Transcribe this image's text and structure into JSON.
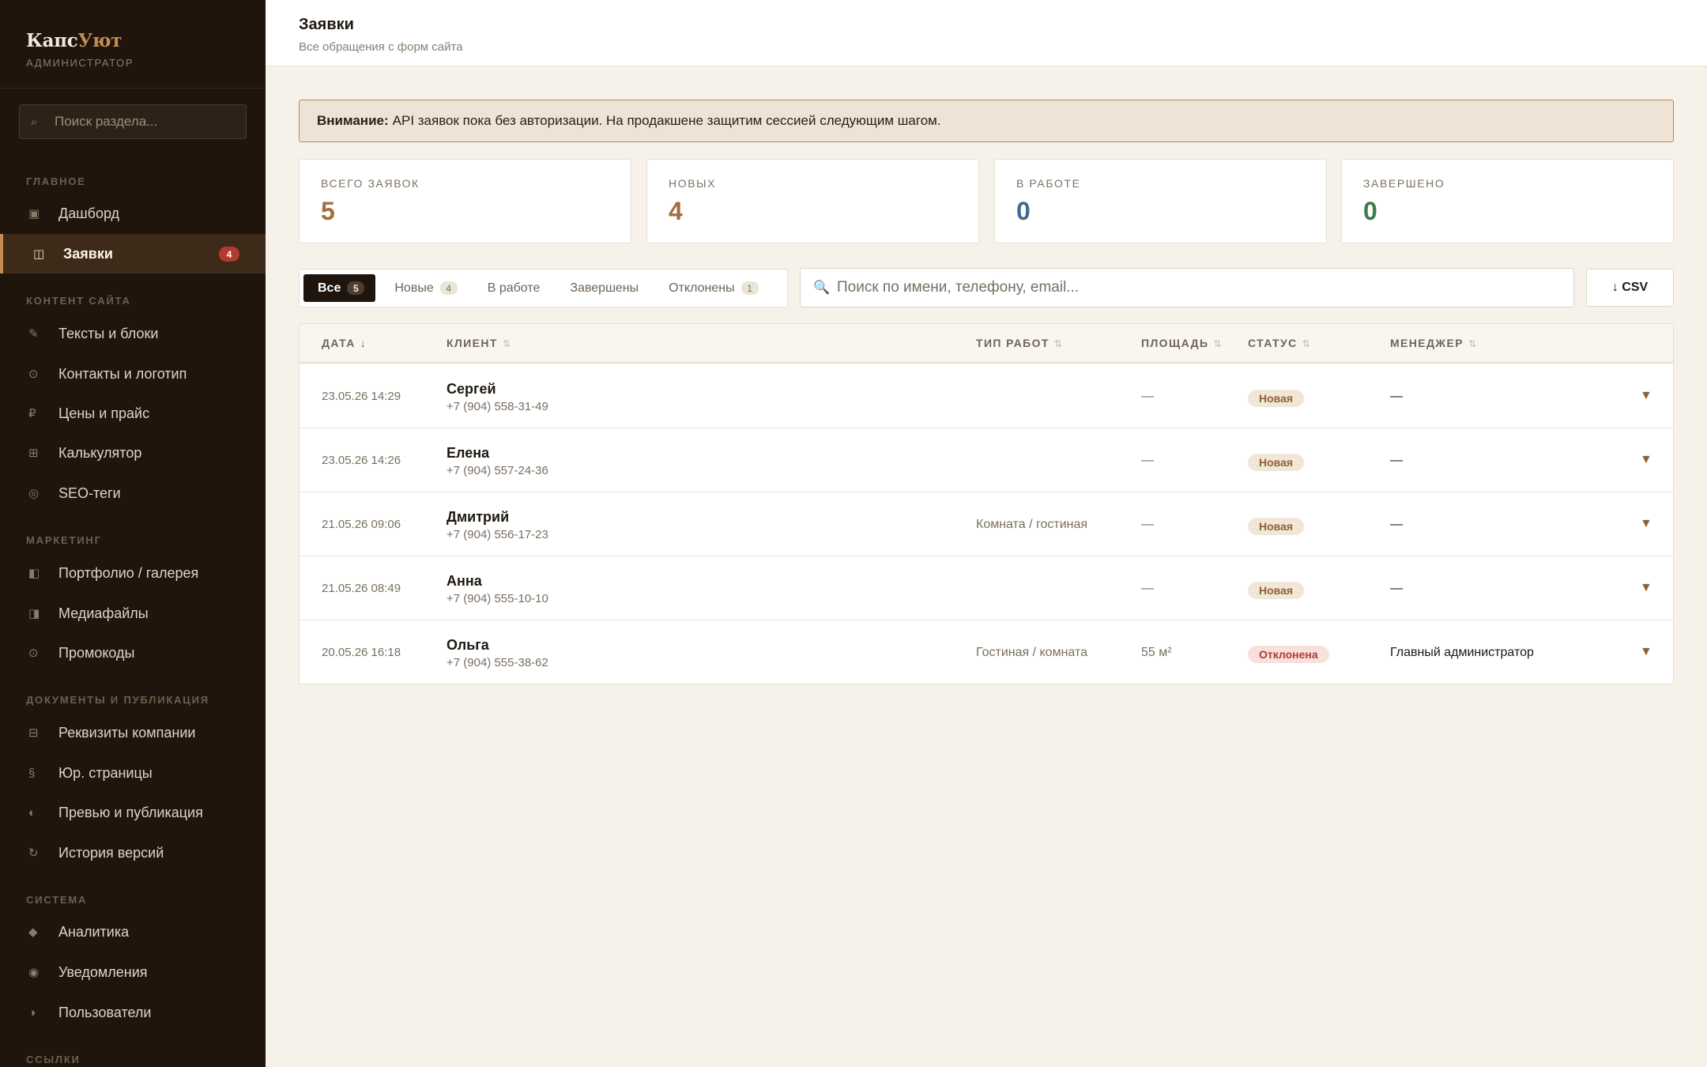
{
  "brand": {
    "part1": "Капс",
    "part2": "Уют",
    "role": "АДМИНИСТРАТОР"
  },
  "sidebar": {
    "search_placeholder": "Поиск раздела...",
    "sections": {
      "main": "ГЛАВНОЕ",
      "content": "КОНТЕНТ САЙТА",
      "marketing": "МАРКЕТИНГ",
      "docs": "ДОКУМЕНТЫ И ПУБЛИКАЦИЯ",
      "system": "СИСТЕМА",
      "links": "ССЫЛКИ"
    },
    "items": {
      "dashboard": "Дашборд",
      "requests": "Заявки",
      "requests_badge": "4",
      "texts": "Тексты и блоки",
      "contacts": "Контакты и логотип",
      "prices": "Цены и прайс",
      "calculator": "Калькулятор",
      "seo": "SEO-теги",
      "portfolio": "Портфолио / галерея",
      "media": "Медиафайлы",
      "promo": "Промокоды",
      "company": "Реквизиты компании",
      "legal": "Юр. страницы",
      "preview": "Превью и публикация",
      "history": "История версий",
      "analytics": "Аналитика",
      "notifications": "Уведомления",
      "users": "Пользователи"
    },
    "icons": {
      "dashboard": "▣",
      "requests": "◫",
      "texts": "✎",
      "contacts": "⊙",
      "prices": "₽",
      "calculator": "⊞",
      "seo": "◎",
      "portfolio": "◧",
      "media": "◨",
      "promo": "⊙",
      "company": "⊟",
      "legal": "§",
      "preview": "◐",
      "history": "↻",
      "analytics": "◆",
      "notifications": "◉",
      "users": "◑"
    }
  },
  "header": {
    "title": "Заявки",
    "subtitle": "Все обращения с форм сайта"
  },
  "alert": {
    "label": "Внимание:",
    "text": "API заявок пока без авторизации. На продакшене защитим сессией следующим шагом."
  },
  "stats": [
    {
      "label": "ВСЕГО ЗАЯВОК",
      "value": "5",
      "color": "#a0703c"
    },
    {
      "label": "НОВЫХ",
      "value": "4",
      "color": "#a0703c"
    },
    {
      "label": "В РАБОТЕ",
      "value": "0",
      "color": "#3f6a96"
    },
    {
      "label": "ЗАВЕРШЕНО",
      "value": "0",
      "color": "#3d7a4c"
    }
  ],
  "filters": {
    "tabs": [
      {
        "label": "Все",
        "count": "5",
        "active": true
      },
      {
        "label": "Новые",
        "count": "4"
      },
      {
        "label": "В работе"
      },
      {
        "label": "Завершены"
      },
      {
        "label": "Отклонены",
        "count": "1"
      }
    ],
    "search_placeholder": "Поиск по имени, телефону, email...",
    "csv_label": "↓ CSV"
  },
  "table": {
    "columns": {
      "date": "ДАТА",
      "client": "КЛИЕНТ",
      "work_type": "ТИП РАБОТ",
      "area": "ПЛОЩАДЬ",
      "status": "СТАТУС",
      "manager": "МЕНЕДЖЕР"
    },
    "sort_active": "↓",
    "sort_idle": "⇅",
    "expand_glyph": "▼",
    "rows": [
      {
        "date": "23.05.26 14:29",
        "name": "Сергей",
        "phone": "+7 (904) 558-31-49",
        "work_type": "",
        "area": "—",
        "status": "Новая",
        "status_kind": "new",
        "manager": "—"
      },
      {
        "date": "23.05.26 14:26",
        "name": "Елена",
        "phone": "+7 (904) 557-24-36",
        "work_type": "",
        "area": "—",
        "status": "Новая",
        "status_kind": "new",
        "manager": "—"
      },
      {
        "date": "21.05.26 09:06",
        "name": "Дмитрий",
        "phone": "+7 (904) 556-17-23",
        "work_type": "Комната / гостиная",
        "area": "—",
        "status": "Новая",
        "status_kind": "new",
        "manager": "—"
      },
      {
        "date": "21.05.26 08:49",
        "name": "Анна",
        "phone": "+7 (904) 555-10-10",
        "work_type": "",
        "area": "—",
        "status": "Новая",
        "status_kind": "new",
        "manager": "—"
      },
      {
        "date": "20.05.26 16:18",
        "name": "Ольга",
        "phone": "+7 (904) 555-38-62",
        "work_type": "Гостиная / комната",
        "area": "55 м²",
        "status": "Отклонена",
        "status_kind": "rejected",
        "manager": "Главный администратор"
      }
    ]
  }
}
